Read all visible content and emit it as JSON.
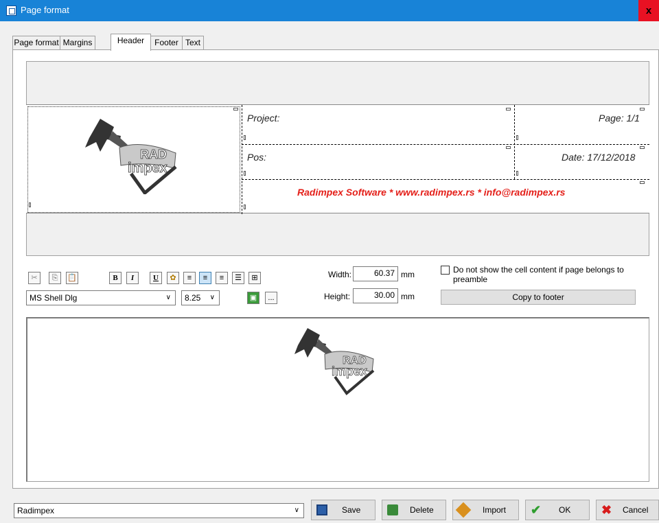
{
  "window": {
    "title": "Page format",
    "close_glyph": "x"
  },
  "tabs": [
    "Page format",
    "Margins",
    "Header",
    "Footer",
    "Text"
  ],
  "active_tab": "Header",
  "header_preview": {
    "project_label": "Project:",
    "page_label": "Page: 1/1",
    "pos_label": "Pos:",
    "date_label": "Date: 17/12/2018",
    "footer_line": "Radimpex Software * www.radimpex.rs * info@radimpex.rs",
    "logo_text_top": "RAD",
    "logo_text_bottom": "impex"
  },
  "toolbar": {
    "icons": [
      "cut-icon",
      "copy-icon",
      "paste-icon",
      "bold-icon",
      "italic-icon",
      "underline-icon",
      "color-icon",
      "align-left-icon",
      "align-center-icon",
      "align-right-icon",
      "list-icon",
      "border-icon"
    ],
    "bold": "B",
    "italic": "I",
    "underline": "U",
    "font_name": "MS Shell Dlg",
    "font_size": "8.25",
    "ellipsis": "..."
  },
  "cell_size": {
    "width_label": "Width:",
    "width_value": "60.37",
    "width_unit": "mm",
    "height_label": "Height:",
    "height_value": "30.00",
    "height_unit": "mm"
  },
  "options": {
    "hide_checkbox_label": "Do not show the cell content if page belongs to preamble",
    "hide_checkbox_checked": false,
    "copy_button": "Copy to footer"
  },
  "bottom": {
    "preset": "Radimpex",
    "save": "Save",
    "delete": "Delete",
    "import": "Import",
    "ok": "OK",
    "cancel": "Cancel"
  },
  "colors": {
    "title_bar": "#1883d7",
    "close": "#e81123",
    "footer_text": "#e4201a"
  }
}
